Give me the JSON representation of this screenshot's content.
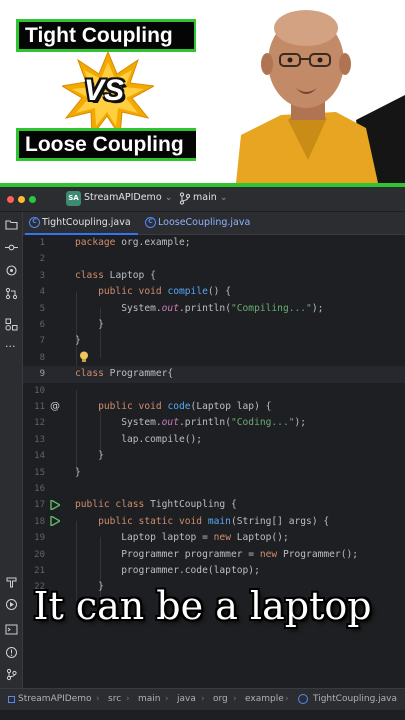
{
  "thumbnail": {
    "title_top": "Tight Coupling",
    "vs_label": "VS",
    "title_bottom": "Loose Coupling",
    "accent": "#31c431"
  },
  "ide": {
    "project_badge": "SA",
    "project_name": "StreamAPIDemo",
    "branch": "main",
    "tabs": [
      {
        "label": "TightCoupling.java",
        "active": true
      },
      {
        "label": "LooseCoupling.java",
        "active": false
      }
    ],
    "sidebar_icons": [
      "folder-icon",
      "commit-icon",
      "structure-icon",
      "git-branch-icon",
      "plugins-icon",
      "more-icon",
      "terminal-icon",
      "run-icon",
      "console-icon",
      "problems-icon",
      "git-icon"
    ],
    "line_numbers": [
      "1",
      "2",
      "3",
      "4",
      "5",
      "6",
      "7",
      "8",
      "9",
      "10",
      "11",
      "12",
      "13",
      "14",
      "15",
      "16",
      "17",
      "18",
      "19",
      "20",
      "21",
      "22"
    ],
    "code": {
      "l1_kw": "package",
      "l1_rest": " org.example;",
      "l3_kw": "class",
      "l3_rest": " Laptop {",
      "l4_kw": "public void",
      "l4_fn": "compile",
      "l4_rest": "() {",
      "l5_sys": "System.",
      "l5_out": "out",
      "l5_println": ".println(",
      "l5_str": "\"Compiling...\"",
      "l5_end": ");",
      "close": "}",
      "l9_kw": "class",
      "l9_rest": " Programmer{",
      "l11_kw": "public void",
      "l11_fn": "code",
      "l11_rest": "(Laptop lap) {",
      "l12_str": "\"Coding...\"",
      "l13": "lap.compile();",
      "l17_kw": "public class",
      "l17_rest": " TightCoupling {",
      "l18_kw": "public static void",
      "l18_fn": "main",
      "l18_rest": "(String[] args) {",
      "l19_type": "Laptop laptop = ",
      "l19_kw": "new",
      "l19_rest": " Laptop();",
      "l20_type": "Programmer programmer = ",
      "l20_kw": "new",
      "l20_rest": " Programmer();",
      "l21": "programmer.code(laptop);"
    },
    "caption": "It can be a laptop",
    "breadcrumb": [
      "StreamAPIDemo",
      "src",
      "main",
      "java",
      "org",
      "example",
      "TightCoupling.java"
    ]
  }
}
